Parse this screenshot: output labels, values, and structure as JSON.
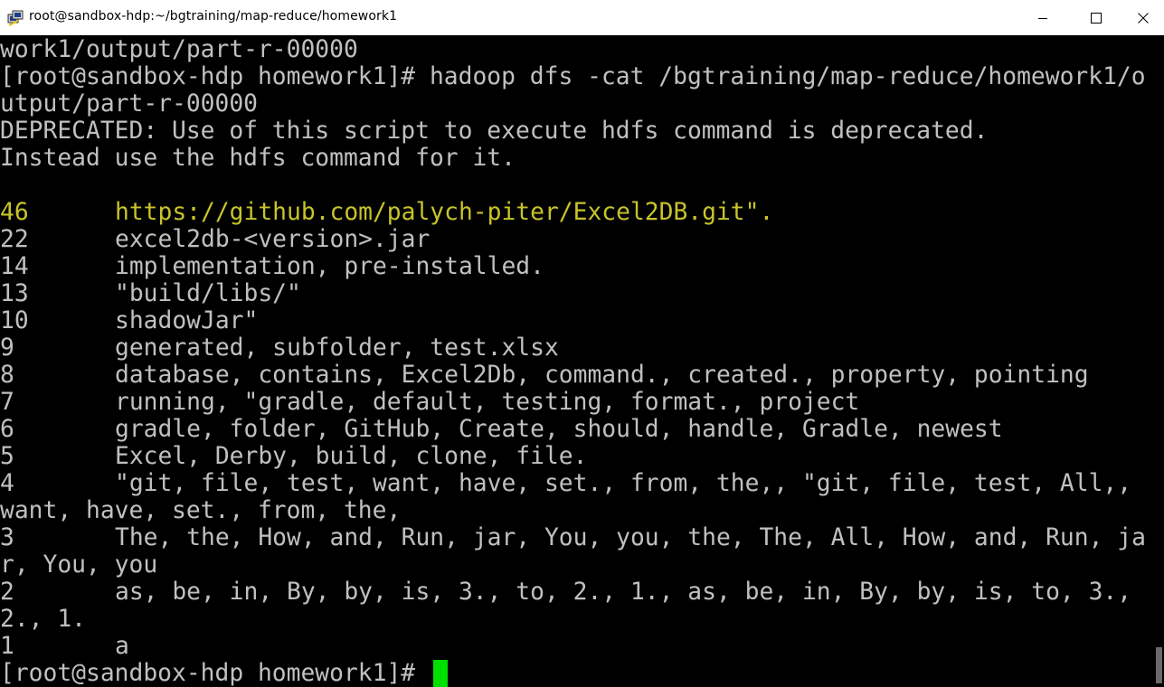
{
  "window": {
    "title": "root@sandbox-hdp:~/bgtraining/map-reduce/homework1",
    "icons": {
      "app": "putty-icon",
      "minimize": "minimize-icon",
      "maximize": "maximize-icon",
      "close": "close-icon"
    }
  },
  "terminal": {
    "lines": [
      "work1/output/part-r-00000",
      "[root@sandbox-hdp homework1]# hadoop dfs -cat /bgtraining/map-reduce/homework1/o",
      "utput/part-r-00000",
      "DEPRECATED: Use of this script to execute hdfs command is deprecated.",
      "Instead use the hdfs command for it."
    ],
    "results": [
      {
        "count": "46",
        "words": "https://github.com/palych-piter/Excel2DB.git\".",
        "highlight": true
      },
      {
        "count": "22",
        "words": "excel2db-<version>.jar"
      },
      {
        "count": "14",
        "words": "implementation, pre-installed."
      },
      {
        "count": "13",
        "words": "\"build/libs/\""
      },
      {
        "count": "10",
        "words": "shadowJar\""
      },
      {
        "count": "9",
        "words": "generated, subfolder, test.xlsx"
      },
      {
        "count": "8",
        "words": "database, contains, Excel2Db, command., created., property, pointing"
      },
      {
        "count": "7",
        "words": "running, \"gradle, default, testing, format., project"
      },
      {
        "count": "6",
        "words": "gradle, folder, GitHub, Create, should, handle, Gradle, newest"
      },
      {
        "count": "5",
        "words": "Excel, Derby, build, clone, file."
      },
      {
        "count": "4",
        "words": "\"git, file, test, want, have, set., from, the,, \"git, file, test, All,,",
        "wrap": "want, have, set., from, the,"
      },
      {
        "count": "3",
        "words": "The, the, How, and, Run, jar, You, you, the, The, All, How, and, Run, ja",
        "wrap": "r, You, you"
      },
      {
        "count": "2",
        "words": "as, be, in, By, by, is, 3., to, 2., 1., as, be, in, By, by, is, to, 3.,",
        "wrap": "2., 1."
      },
      {
        "count": "1",
        "words": "a"
      }
    ],
    "prompt": "[root@sandbox-hdp homework1]# ",
    "colors": {
      "background": "#000000",
      "text": "#c0c0c0",
      "url": "#c7c42a",
      "cursor": "#00e000"
    }
  }
}
